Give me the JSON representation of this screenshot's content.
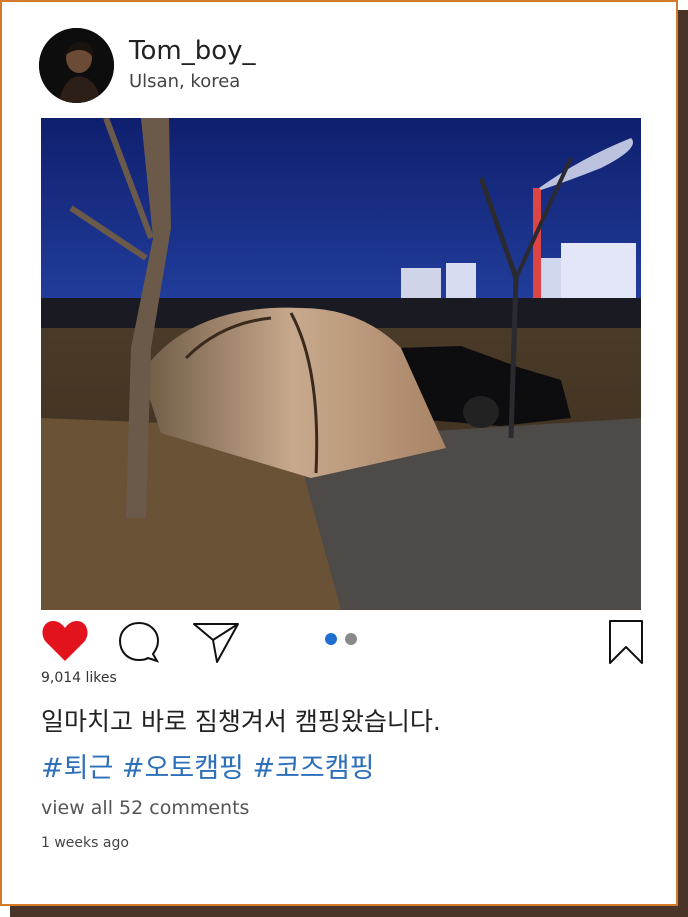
{
  "post": {
    "username": "Tom_boy_",
    "location": "Ulsan, korea",
    "likes": "9,014 likes",
    "caption": "일마치고 바로 짐챙겨서 캠핑왔습니다.",
    "hashtags": "#퇴근 #오토캠핑 #코즈캠핑",
    "comments_link": "view all 52 comments",
    "time": "1 weeks ago",
    "photo_count": 2,
    "photo_index": 1
  },
  "icons": {
    "like": "heart-icon",
    "comment": "comment-bubble-icon",
    "share": "send-icon",
    "save": "bookmark-icon"
  },
  "colors": {
    "frame_border": "#d47a2a",
    "frame_shadow": "#4a3428",
    "like_red": "#e3131e",
    "hashtag_blue": "#2d6fb8",
    "dot_active": "#1f6fd1",
    "dot_inactive": "#8a8a8a"
  }
}
